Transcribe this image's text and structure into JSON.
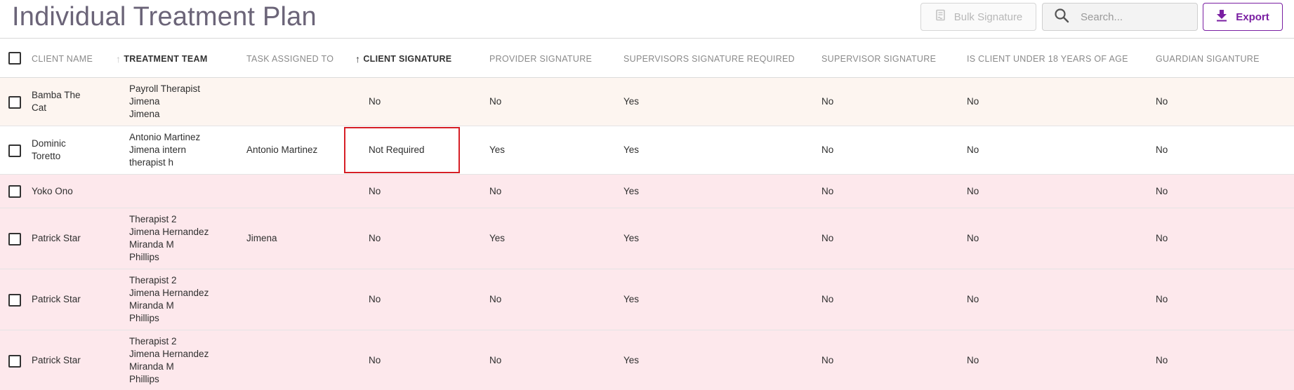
{
  "page": {
    "title": "Individual Treatment Plan"
  },
  "toolbar": {
    "bulk_signature_label": "Bulk Signature",
    "search_placeholder": "Search...",
    "export_label": "Export"
  },
  "colors": {
    "accent": "#7a1fa2",
    "highlight_border": "#d61f26",
    "row_peach": "#fdf5f0",
    "row_pink": "#fde8ec"
  },
  "table": {
    "sort_column": "CLIENT SIGNATURE",
    "columns": [
      "CLIENT NAME",
      "TREATMENT TEAM",
      "TASK ASSIGNED TO",
      "CLIENT SIGNATURE",
      "PROVIDER SIGNATURE",
      "SUPERVISORS SIGNATURE REQUIRED",
      "SUPERVISOR SIGNATURE",
      "IS CLIENT UNDER 18 YEARS OF AGE",
      "GUARDIAN SIGANTURE"
    ],
    "rows": [
      {
        "client_name": [
          "Bamba The",
          "Cat"
        ],
        "team": [
          "Payroll Therapist",
          "Jimena",
          "Jimena"
        ],
        "task": "",
        "client_sig": "No",
        "provider_sig": "No",
        "sup_req": "Yes",
        "sup_sig": "No",
        "under18": "No",
        "guardian": "No",
        "tint": "peach"
      },
      {
        "client_name": [
          "Dominic",
          "Toretto"
        ],
        "team": [
          "Antonio Martinez",
          "Jimena intern",
          "therapist h"
        ],
        "task": "Antonio Martinez",
        "client_sig": "Not Required",
        "provider_sig": "Yes",
        "sup_req": "Yes",
        "sup_sig": "No",
        "under18": "No",
        "guardian": "No",
        "tint": "white",
        "highlighted": true
      },
      {
        "client_name": [
          "Yoko Ono"
        ],
        "team": [],
        "task": "",
        "client_sig": "No",
        "provider_sig": "No",
        "sup_req": "Yes",
        "sup_sig": "No",
        "under18": "No",
        "guardian": "No",
        "tint": "pink"
      },
      {
        "client_name": [
          "Patrick Star"
        ],
        "team": [
          "Therapist 2",
          "Jimena Hernandez",
          "Miranda M",
          "Phillips"
        ],
        "task": "Jimena",
        "client_sig": "No",
        "provider_sig": "Yes",
        "sup_req": "Yes",
        "sup_sig": "No",
        "under18": "No",
        "guardian": "No",
        "tint": "pink"
      },
      {
        "client_name": [
          "Patrick Star"
        ],
        "team": [
          "Therapist 2",
          "Jimena Hernandez",
          "Miranda M",
          "Phillips"
        ],
        "task": "",
        "client_sig": "No",
        "provider_sig": "No",
        "sup_req": "Yes",
        "sup_sig": "No",
        "under18": "No",
        "guardian": "No",
        "tint": "pink"
      },
      {
        "client_name": [
          "Patrick Star"
        ],
        "team": [
          "Therapist 2",
          "Jimena Hernandez",
          "Miranda M",
          "Phillips"
        ],
        "task": "",
        "client_sig": "No",
        "provider_sig": "No",
        "sup_req": "Yes",
        "sup_sig": "No",
        "under18": "No",
        "guardian": "No",
        "tint": "pink"
      }
    ]
  }
}
